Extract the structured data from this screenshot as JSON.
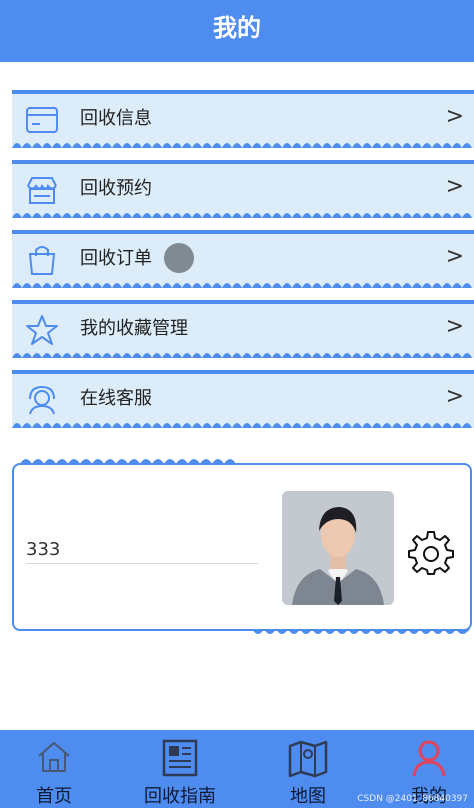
{
  "header": {
    "title": "我的"
  },
  "menu": [
    {
      "label": "回收信息",
      "icon": "card-icon"
    },
    {
      "label": "回收预约",
      "icon": "store-icon"
    },
    {
      "label": "回收订单",
      "icon": "bag-icon"
    },
    {
      "label": "我的收藏管理",
      "icon": "star-icon"
    },
    {
      "label": "在线客服",
      "icon": "headset-icon"
    }
  ],
  "chevron": ">",
  "profile": {
    "username": "333",
    "avatar": "user-photo",
    "settings_icon": "gear-icon"
  },
  "tabs": [
    {
      "label": "首页",
      "icon": "home-icon"
    },
    {
      "label": "回收指南",
      "icon": "newspaper-icon"
    },
    {
      "label": "地图",
      "icon": "map-icon"
    },
    {
      "label": "我的",
      "icon": "person-icon"
    }
  ],
  "watermark": "CSDN @2401_86840397",
  "colors": {
    "primary": "#4f8cf0",
    "item_bg": "#dcedf9",
    "active_tab": "#e0445c"
  }
}
